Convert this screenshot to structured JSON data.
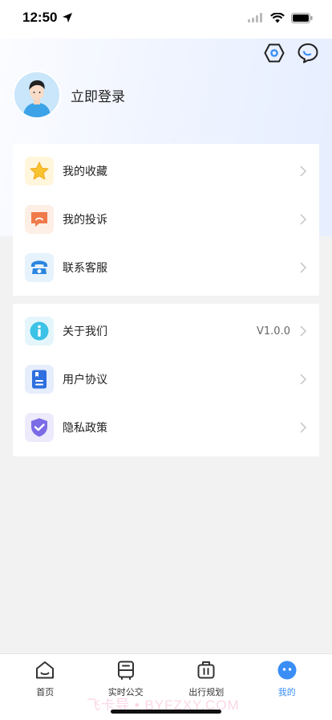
{
  "status_bar": {
    "time": "12:50"
  },
  "profile": {
    "login_label": "立即登录"
  },
  "menu_group_1": [
    {
      "label": "我的收藏",
      "icon": "star-icon"
    },
    {
      "label": "我的投诉",
      "icon": "complaint-icon"
    },
    {
      "label": "联系客服",
      "icon": "phone-icon"
    }
  ],
  "menu_group_2": [
    {
      "label": "关于我们",
      "icon": "info-icon",
      "value": "V1.0.0"
    },
    {
      "label": "用户协议",
      "icon": "document-icon"
    },
    {
      "label": "隐私政策",
      "icon": "shield-check-icon"
    }
  ],
  "tabs": [
    {
      "label": "首页",
      "icon": "home-icon",
      "active": false
    },
    {
      "label": "实时公交",
      "icon": "bus-icon",
      "active": false
    },
    {
      "label": "出行规划",
      "icon": "luggage-icon",
      "active": false
    },
    {
      "label": "我的",
      "icon": "profile-face-icon",
      "active": true
    }
  ],
  "watermark": "飞卡导 • BYFZXY.COM",
  "colors": {
    "accent": "#3a8ef6",
    "background": "#f2f2f2"
  }
}
